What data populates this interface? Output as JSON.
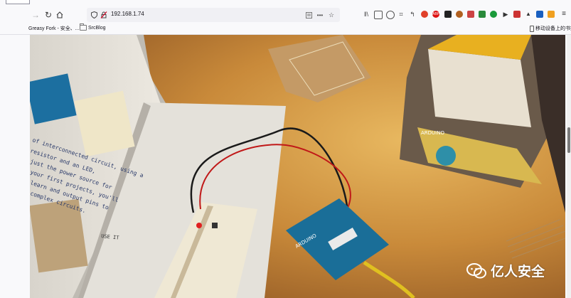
{
  "browser": {
    "url": "192.168.1.74",
    "more_label": "•••",
    "bookmarks": [
      {
        "label": "Greasy Fork - 安全、..."
      },
      {
        "label": "SrcBlog"
      }
    ],
    "mobile_bookmarks_label": "移动设备上的书签",
    "colors": {
      "toolbar": "#f9f9fb",
      "urlbar": "#f0f0f4"
    }
  },
  "article": {
    "image_alt": "Arduino starter kit: project book, breadboard with LED and button, Arduino Uno board, kit box",
    "book_text": [
      "of interconnected circuit, using a",
      "resistor and an LED,",
      "just the power source for",
      "your first projects, you'll",
      "learn and output pins to",
      "complex circuits."
    ],
    "book_caption": "USE IT",
    "board_logo": "ARDUINO",
    "box_label": "ARDUINO"
  },
  "watermark": {
    "text": "亿人安全",
    "icon": "wechat-icon"
  }
}
